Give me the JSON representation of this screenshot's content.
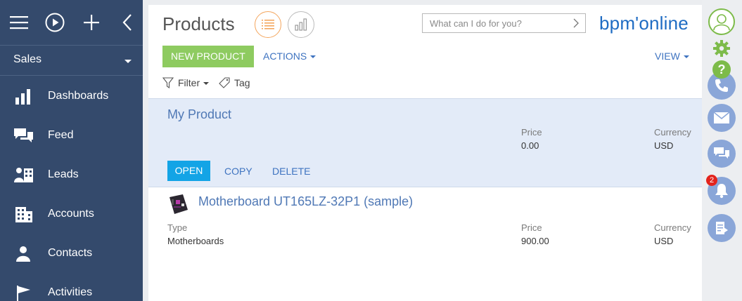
{
  "sidebar": {
    "workspace": "Sales",
    "items": [
      {
        "label": "Dashboards",
        "icon": "bar-chart-icon"
      },
      {
        "label": "Feed",
        "icon": "chat-bubbles-icon"
      },
      {
        "label": "Leads",
        "icon": "lead-icon"
      },
      {
        "label": "Accounts",
        "icon": "building-icon"
      },
      {
        "label": "Contacts",
        "icon": "person-icon"
      },
      {
        "label": "Activities",
        "icon": "flag-icon"
      }
    ]
  },
  "header": {
    "title": "Products",
    "search_placeholder": "What can I do for you?",
    "logo": "bpm'online"
  },
  "toolbar": {
    "new_label": "NEW PRODUCT",
    "actions_label": "ACTIONS",
    "view_label": "VIEW"
  },
  "filters": {
    "filter_label": "Filter",
    "tag_label": "Tag"
  },
  "records": [
    {
      "title": "My Product",
      "price_caption": "Price",
      "price": "0.00",
      "currency_caption": "Currency",
      "currency": "USD",
      "actions": {
        "open": "OPEN",
        "copy": "COPY",
        "delete": "DELETE"
      }
    },
    {
      "title": "Motherboard UT165LZ-32P1 (sample)",
      "type_caption": "Type",
      "type": "Motherboards",
      "price_caption": "Price",
      "price": "900.00",
      "currency_caption": "Currency",
      "currency": "USD"
    }
  ],
  "rightbar": {
    "notification_count": "2"
  },
  "colors": {
    "sidebar": "#344a6c",
    "accent_green": "#8ecb60",
    "open_button": "#13a4e6",
    "link_blue": "#3e73c0",
    "selected_row": "#e3ebf8",
    "right_icons": "#8aa6d8",
    "logo_blue": "#1f6cc3"
  }
}
